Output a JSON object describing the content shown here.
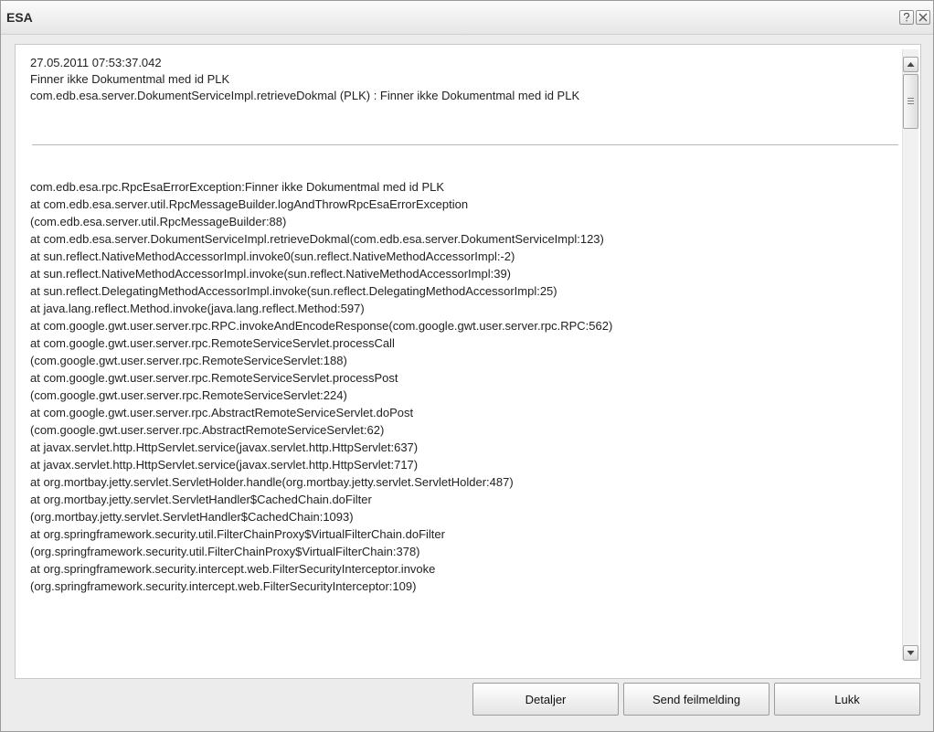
{
  "window": {
    "title": "ESA",
    "help_icon": "question-icon",
    "close_icon": "close-icon"
  },
  "message": {
    "timestamp": "27.05.2011 07:53:37.042",
    "summary": "Finner ikke Dokumentmal med id PLK",
    "detail": "com.edb.esa.server.DokumentServiceImpl.retrieveDokmal (PLK) : Finner ikke Dokumentmal med id PLK"
  },
  "stacktrace": [
    "com.edb.esa.rpc.RpcEsaErrorException:Finner ikke Dokumentmal med id PLK",
    "at com.edb.esa.server.util.RpcMessageBuilder.logAndThrowRpcEsaErrorException",
    "(com.edb.esa.server.util.RpcMessageBuilder:88)",
    "at com.edb.esa.server.DokumentServiceImpl.retrieveDokmal(com.edb.esa.server.DokumentServiceImpl:123)",
    "at sun.reflect.NativeMethodAccessorImpl.invoke0(sun.reflect.NativeMethodAccessorImpl:-2)",
    "at sun.reflect.NativeMethodAccessorImpl.invoke(sun.reflect.NativeMethodAccessorImpl:39)",
    "at sun.reflect.DelegatingMethodAccessorImpl.invoke(sun.reflect.DelegatingMethodAccessorImpl:25)",
    "at java.lang.reflect.Method.invoke(java.lang.reflect.Method:597)",
    "at com.google.gwt.user.server.rpc.RPC.invokeAndEncodeResponse(com.google.gwt.user.server.rpc.RPC:562)",
    "at com.google.gwt.user.server.rpc.RemoteServiceServlet.processCall",
    "(com.google.gwt.user.server.rpc.RemoteServiceServlet:188)",
    "at com.google.gwt.user.server.rpc.RemoteServiceServlet.processPost",
    "(com.google.gwt.user.server.rpc.RemoteServiceServlet:224)",
    "at com.google.gwt.user.server.rpc.AbstractRemoteServiceServlet.doPost",
    "(com.google.gwt.user.server.rpc.AbstractRemoteServiceServlet:62)",
    "at javax.servlet.http.HttpServlet.service(javax.servlet.http.HttpServlet:637)",
    "at javax.servlet.http.HttpServlet.service(javax.servlet.http.HttpServlet:717)",
    "at org.mortbay.jetty.servlet.ServletHolder.handle(org.mortbay.jetty.servlet.ServletHolder:487)",
    "at org.mortbay.jetty.servlet.ServletHandler$CachedChain.doFilter",
    "(org.mortbay.jetty.servlet.ServletHandler$CachedChain:1093)",
    "at org.springframework.security.util.FilterChainProxy$VirtualFilterChain.doFilter",
    "(org.springframework.security.util.FilterChainProxy$VirtualFilterChain:378)",
    "at org.springframework.security.intercept.web.FilterSecurityInterceptor.invoke",
    "(org.springframework.security.intercept.web.FilterSecurityInterceptor:109)"
  ],
  "buttons": {
    "details_label": "Detaljer",
    "send_label": "Send feilmelding",
    "close_label": "Lukk"
  }
}
